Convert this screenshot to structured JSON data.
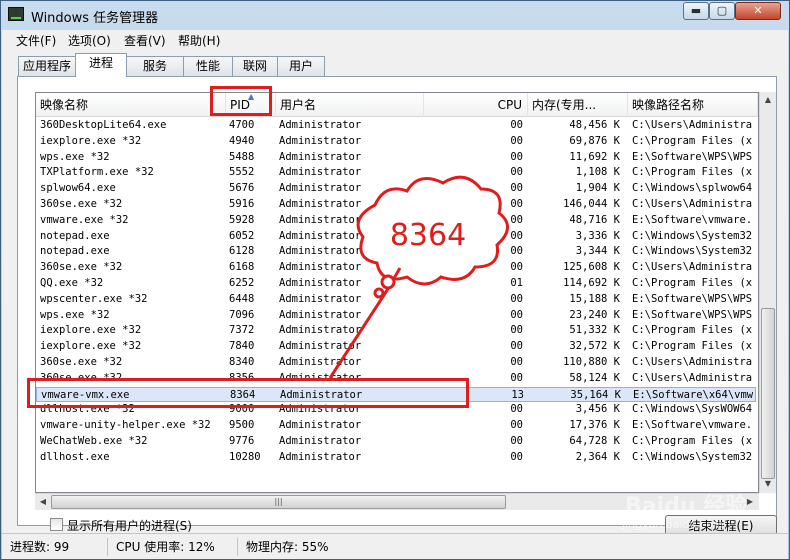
{
  "window": {
    "title": "Windows 任务管理器",
    "min": "▬",
    "max": "▢",
    "close": "✕"
  },
  "menu": [
    "文件(F)",
    "选项(O)",
    "查看(V)",
    "帮助(H)"
  ],
  "tabs": [
    "应用程序",
    "进程",
    "服务",
    "性能",
    "联网",
    "用户"
  ],
  "active_tab": "进程",
  "columns": {
    "name": "映像名称",
    "pid": "PID",
    "user": "用户名",
    "cpu": "CPU",
    "mem": "内存(专用...",
    "path": "映像路径名称"
  },
  "rows": [
    {
      "name": "360DesktopLite64.exe",
      "pid": "4700",
      "user": "Administrator",
      "cpu": "00",
      "mem": "48,456 K",
      "path": "C:\\Users\\Administra"
    },
    {
      "name": "iexplore.exe *32",
      "pid": "4940",
      "user": "Administrator",
      "cpu": "00",
      "mem": "69,876 K",
      "path": "C:\\Program Files (x"
    },
    {
      "name": "wps.exe *32",
      "pid": "5488",
      "user": "Administrator",
      "cpu": "00",
      "mem": "11,692 K",
      "path": "E:\\Software\\WPS\\WPS"
    },
    {
      "name": "TXPlatform.exe *32",
      "pid": "5552",
      "user": "Administrator",
      "cpu": "00",
      "mem": "1,108 K",
      "path": "C:\\Program Files (x"
    },
    {
      "name": "splwow64.exe",
      "pid": "5676",
      "user": "Administrator",
      "cpu": "00",
      "mem": "1,904 K",
      "path": "C:\\Windows\\splwow64"
    },
    {
      "name": "360se.exe *32",
      "pid": "5916",
      "user": "Administrator",
      "cpu": "00",
      "mem": "146,044 K",
      "path": "C:\\Users\\Administra"
    },
    {
      "name": "vmware.exe *32",
      "pid": "5928",
      "user": "Administrator",
      "cpu": "00",
      "mem": "48,716 K",
      "path": "E:\\Software\\vmware."
    },
    {
      "name": "notepad.exe",
      "pid": "6052",
      "user": "Administrator",
      "cpu": "00",
      "mem": "3,336 K",
      "path": "C:\\Windows\\System32"
    },
    {
      "name": "notepad.exe",
      "pid": "6128",
      "user": "Administrator",
      "cpu": "00",
      "mem": "3,344 K",
      "path": "C:\\Windows\\System32"
    },
    {
      "name": "360se.exe *32",
      "pid": "6168",
      "user": "Administrator",
      "cpu": "00",
      "mem": "125,608 K",
      "path": "C:\\Users\\Administra"
    },
    {
      "name": "QQ.exe *32",
      "pid": "6252",
      "user": "Administrator",
      "cpu": "01",
      "mem": "114,692 K",
      "path": "C:\\Program Files (x"
    },
    {
      "name": "wpscenter.exe *32",
      "pid": "6448",
      "user": "Administrator",
      "cpu": "00",
      "mem": "15,188 K",
      "path": "E:\\Software\\WPS\\WPS"
    },
    {
      "name": "wps.exe *32",
      "pid": "7096",
      "user": "Administrator",
      "cpu": "00",
      "mem": "23,240 K",
      "path": "E:\\Software\\WPS\\WPS"
    },
    {
      "name": "iexplore.exe *32",
      "pid": "7372",
      "user": "Administrator",
      "cpu": "00",
      "mem": "51,332 K",
      "path": "C:\\Program Files (x"
    },
    {
      "name": "iexplore.exe *32",
      "pid": "7840",
      "user": "Administrator",
      "cpu": "00",
      "mem": "32,572 K",
      "path": "C:\\Program Files (x"
    },
    {
      "name": "360se.exe *32",
      "pid": "8340",
      "user": "Administrator",
      "cpu": "00",
      "mem": "110,880 K",
      "path": "C:\\Users\\Administra"
    },
    {
      "name": "360se.exe *32",
      "pid": "8356",
      "user": "Administrator",
      "cpu": "00",
      "mem": "58,124 K",
      "path": "C:\\Users\\Administra"
    },
    {
      "name": "vmware-vmx.exe",
      "pid": "8364",
      "user": "Administrator",
      "cpu": "13",
      "mem": "35,164 K",
      "path": "E:\\Software\\x64\\vmw"
    },
    {
      "name": "dllhost.exe *32",
      "pid": "9000",
      "user": "Administrator",
      "cpu": "00",
      "mem": "3,456 K",
      "path": "C:\\Windows\\SysWOW64"
    },
    {
      "name": "vmware-unity-helper.exe *32",
      "pid": "9500",
      "user": "Administrator",
      "cpu": "00",
      "mem": "17,376 K",
      "path": "E:\\Software\\vmware."
    },
    {
      "name": "WeChatWeb.exe *32",
      "pid": "9776",
      "user": "Administrator",
      "cpu": "00",
      "mem": "64,728 K",
      "path": "C:\\Program Files (x"
    },
    {
      "name": "dllhost.exe",
      "pid": "10280",
      "user": "Administrator",
      "cpu": "00",
      "mem": "2,364 K",
      "path": "C:\\Windows\\System32"
    }
  ],
  "selected_row_index": 17,
  "show_all_users_label": "显示所有用户的进程(S)",
  "end_process_label": "结束进程(E)",
  "status": {
    "processes": "进程数: 99",
    "cpu": "CPU 使用率: 12%",
    "memory": "物理内存: 55%"
  },
  "annotation": {
    "callout_text": "8364",
    "color": "#e01d1d"
  },
  "watermark": {
    "brand": "Baidu 经验",
    "url": "jingyan.baidu.com"
  },
  "hscroll_grip": "|||"
}
